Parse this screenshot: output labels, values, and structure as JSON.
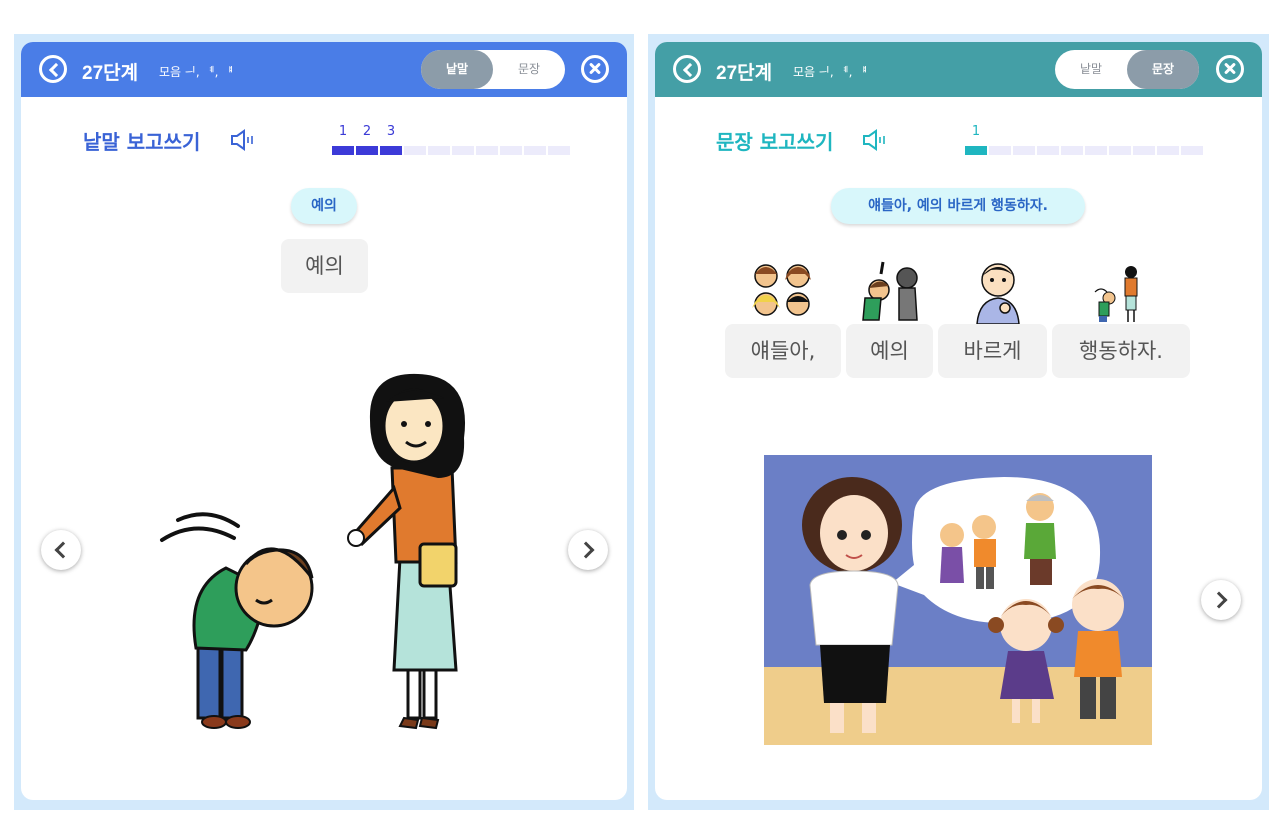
{
  "left_panel": {
    "level_title": "27단계",
    "vowel_label": "모음 ᅴ, ᅨ, ᅤ",
    "mode_toggle": {
      "options": [
        "낱말",
        "문장"
      ],
      "active": "낱말"
    },
    "section_title": "낱말 보고쓰기",
    "progress": {
      "numbers": [
        "1",
        "2",
        "3"
      ],
      "done": 3,
      "total": 10
    },
    "word_pill": "예의",
    "answer_box": "예의",
    "illustration": "boy-bowing-to-woman"
  },
  "right_panel": {
    "level_title": "27단계",
    "vowel_label": "모음 ᅴ, ᅨ, ᅤ",
    "mode_toggle": {
      "options": [
        "낱말",
        "문장"
      ],
      "active": "문장"
    },
    "section_title": "문장 보고쓰기",
    "progress": {
      "numbers": [
        "1"
      ],
      "done": 1,
      "total": 10
    },
    "sentence_pill": "얘들아, 예의 바르게 행동하자.",
    "word_cards": [
      {
        "text": "얘들아,",
        "icon": "children-icon"
      },
      {
        "text": "예의",
        "icon": "bowing-icon"
      },
      {
        "text": "바르게",
        "icon": "thinking-boy-icon"
      },
      {
        "text": "행동하자.",
        "icon": "bowing-to-adult-icon"
      }
    ],
    "illustration": "teacher-explaining-manners-to-children"
  },
  "colors": {
    "left_header": "#4a7de7",
    "right_header": "#449fa6",
    "panel_background": "#d3e9fb",
    "progress_left": "#3c3ad8",
    "progress_right": "#1fb6c0"
  }
}
